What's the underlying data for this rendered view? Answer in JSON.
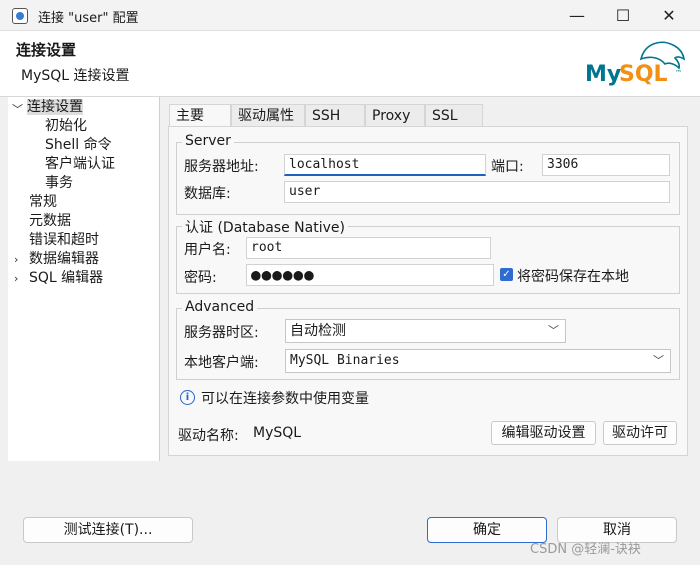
{
  "window": {
    "title": "连接 \"user\" 配置",
    "min_glyph": "—",
    "max_glyph": "☐",
    "close_glyph": "✕"
  },
  "header": {
    "title": "连接设置",
    "subtitle": "MySQL 连接设置",
    "logo_text": "MySQL",
    "logo_tm": "™"
  },
  "sidebar": {
    "items": [
      {
        "label": "连接设置",
        "expanded": true
      },
      {
        "label": "初始化"
      },
      {
        "label": "Shell 命令"
      },
      {
        "label": "客户端认证"
      },
      {
        "label": "事务"
      },
      {
        "label": "常规"
      },
      {
        "label": "元数据"
      },
      {
        "label": "错误和超时"
      },
      {
        "label": "数据编辑器",
        "collapsed": true
      },
      {
        "label": "SQL 编辑器",
        "collapsed": true
      }
    ]
  },
  "tabs": [
    "主要",
    "驱动属性",
    "SSH",
    "Proxy",
    "SSL"
  ],
  "server": {
    "group_label": "Server",
    "host_label": "服务器地址:",
    "host_value": "localhost",
    "port_label": "端口:",
    "port_value": "3306",
    "db_label": "数据库:",
    "db_value": "user"
  },
  "auth": {
    "group_label": "认证 (Database Native)",
    "user_label": "用户名:",
    "user_value": "root",
    "pass_label": "密码:",
    "pass_value": "●●●●●●",
    "save_password_label": "将密码保存在本地",
    "save_password_checked": true
  },
  "advanced": {
    "group_label": "Advanced",
    "timezone_label": "服务器时区:",
    "timezone_value": "自动检测",
    "client_label": "本地客户端:",
    "client_value": "MySQL Binaries"
  },
  "info": {
    "text": "可以在连接参数中使用变量"
  },
  "driver": {
    "name_label": "驱动名称:",
    "name_value": "MySQL",
    "edit_button": "编辑驱动设置",
    "license_button": "驱动许可"
  },
  "footer": {
    "test_button": "测试连接(T)...",
    "ok_button": "确定",
    "cancel_button": "取消"
  },
  "watermark": "CSDN @轻澜-诀袂",
  "colors": {
    "accent": "#2f6bd1",
    "mysql_blue": "#00758f",
    "mysql_orange": "#f29111"
  }
}
